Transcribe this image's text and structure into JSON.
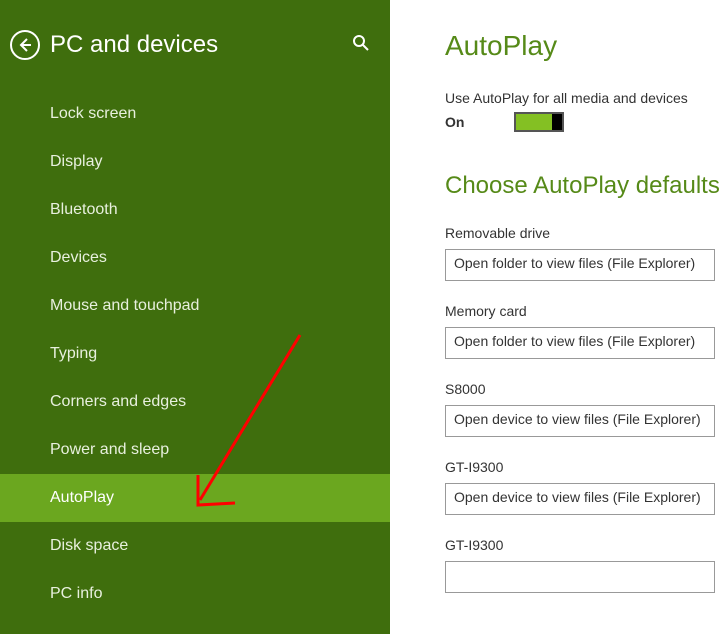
{
  "sidebar": {
    "title": "PC and devices",
    "items": [
      {
        "label": "Lock screen",
        "selected": false
      },
      {
        "label": "Display",
        "selected": false
      },
      {
        "label": "Bluetooth",
        "selected": false
      },
      {
        "label": "Devices",
        "selected": false
      },
      {
        "label": "Mouse and touchpad",
        "selected": false
      },
      {
        "label": "Typing",
        "selected": false
      },
      {
        "label": "Corners and edges",
        "selected": false
      },
      {
        "label": "Power and sleep",
        "selected": false
      },
      {
        "label": "AutoPlay",
        "selected": true
      },
      {
        "label": "Disk space",
        "selected": false
      },
      {
        "label": "PC info",
        "selected": false
      }
    ]
  },
  "content": {
    "title": "AutoPlay",
    "toggle": {
      "label": "Use AutoPlay for all media and devices",
      "state": "On"
    },
    "defaults_heading": "Choose AutoPlay defaults",
    "devices": [
      {
        "label": "Removable drive",
        "value": "Open folder to view files (File Explorer)"
      },
      {
        "label": "Memory card",
        "value": "Open folder to view files (File Explorer)"
      },
      {
        "label": "S8000",
        "value": "Open device to view files (File Explorer)"
      },
      {
        "label": "GT-I9300",
        "value": "Open device to view files (File Explorer)"
      },
      {
        "label": "GT-I9300",
        "value": ""
      }
    ]
  },
  "colors": {
    "sidebar_bg": "#3f6e0d",
    "selected_bg": "#6ba71f",
    "accent": "#568a18",
    "toggle_on": "#84c023",
    "annotation": "#ff0000"
  }
}
